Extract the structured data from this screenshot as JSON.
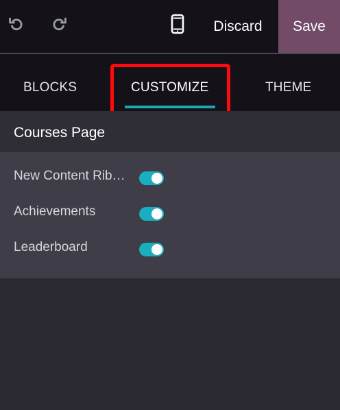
{
  "toolbar": {
    "undo_icon": "undo-icon",
    "redo_icon": "redo-icon",
    "mobile_icon": "mobile-phone-icon",
    "discard_label": "Discard",
    "save_label": "Save",
    "save_color": "#714b67"
  },
  "tabs": [
    {
      "label": "BLOCKS",
      "active": false
    },
    {
      "label": "CUSTOMIZE",
      "active": true
    },
    {
      "label": "THEME",
      "active": false
    }
  ],
  "accent_color": "#1fa6b5",
  "highlight_color": "#ff0a0a",
  "section": {
    "title": "Courses Page",
    "options": [
      {
        "label": "New Content Ribbon",
        "enabled": true
      },
      {
        "label": "Achievements",
        "enabled": true
      },
      {
        "label": "Leaderboard",
        "enabled": true
      }
    ]
  }
}
